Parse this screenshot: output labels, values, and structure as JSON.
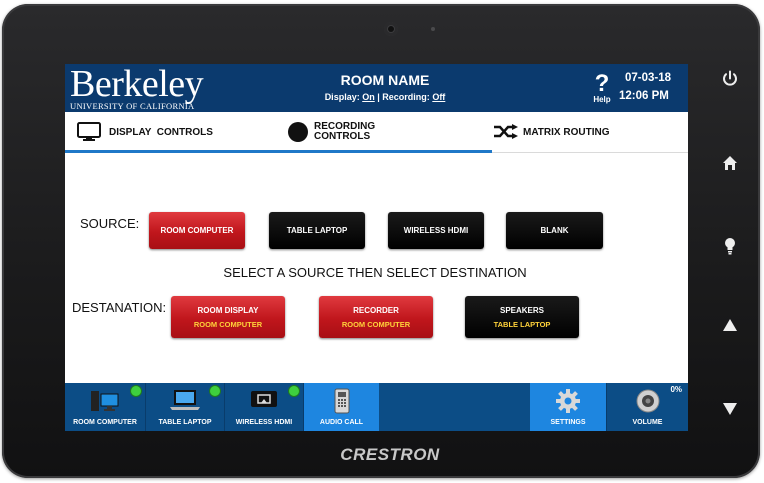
{
  "header": {
    "logo_word": "Berkeley",
    "logo_sub": "UNIVERSITY OF CALIFORNIA",
    "room_name": "ROOM NAME",
    "display_label": "Display:",
    "display_state": "On",
    "separator": "|",
    "recording_label": "Recording:",
    "recording_state": "Off",
    "help_symbol": "?",
    "help_label": "Help",
    "date": "07-03-18",
    "time": "12:06 PM"
  },
  "tabs": [
    {
      "label": "DISPLAY  CONTROLS",
      "icon": "monitor-icon"
    },
    {
      "label_line1": "RECORDING",
      "label_line2": "CONTROLS",
      "icon": "record-dot-icon"
    },
    {
      "label": "MATRIX ROUTING",
      "icon": "shuffle-icon"
    }
  ],
  "routing": {
    "source_label": "SOURCE:",
    "sources": [
      "ROOM COMPUTER",
      "TABLE LAPTOP",
      "WIRELESS HDMI",
      "BLANK"
    ],
    "selected_source": "ROOM COMPUTER",
    "instruction": "SELECT A SOURCE THEN SELECT DESTINATION",
    "destination_label": "DESTANATION:",
    "destinations": [
      {
        "name": "ROOM DISPLAY",
        "current": "ROOM COMPUTER",
        "style": "red"
      },
      {
        "name": "RECORDER",
        "current": "ROOM COMPUTER",
        "style": "red"
      },
      {
        "name": "SPEAKERS",
        "current": "TABLE LAPTOP",
        "style": "black"
      }
    ]
  },
  "footer": {
    "items": [
      {
        "label": "ROOM COMPUTER",
        "icon": "desktop-computer-icon",
        "status": "active"
      },
      {
        "label": "TABLE LAPTOP",
        "icon": "laptop-icon",
        "status": "active"
      },
      {
        "label": "WIRELESS HDMI",
        "icon": "wireless-hdmi-icon",
        "status": "active"
      },
      {
        "label": "AUDIO CALL",
        "icon": "phone-icon"
      },
      {
        "label": "SETTINGS",
        "icon": "gear-icon"
      },
      {
        "label": "VOLUME",
        "icon": "speaker-icon",
        "level": "0%"
      }
    ]
  },
  "device": {
    "brand": "CRESTRON",
    "side_buttons": [
      "power-icon",
      "home-icon",
      "lightbulb-icon",
      "up-arrow-icon",
      "down-arrow-icon"
    ]
  },
  "colors": {
    "header_bg": "#0b3a6e",
    "footer_bg": "#0c4d86",
    "footer_active": "#1e86e0",
    "tab_underline": "#1f78c8",
    "red_button": "#c0161c",
    "status_green": "#3ecf3e",
    "sub_label_yellow": "#ffd23a"
  }
}
